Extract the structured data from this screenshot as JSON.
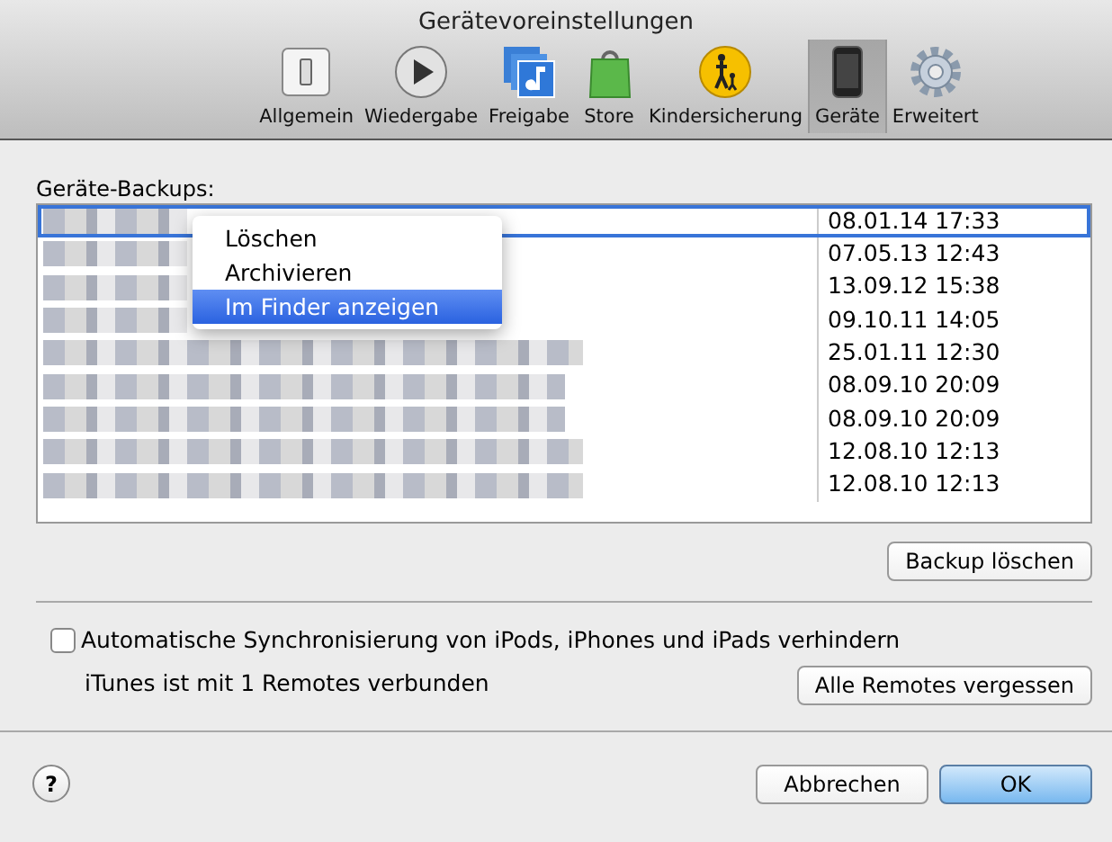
{
  "window": {
    "title": "Gerätevoreinstellungen"
  },
  "toolbar": [
    {
      "label": "Allgemein",
      "kind": "switch",
      "selected": false
    },
    {
      "label": "Wiedergabe",
      "kind": "play",
      "selected": false
    },
    {
      "label": "Freigabe",
      "kind": "sharing",
      "selected": false
    },
    {
      "label": "Store",
      "kind": "store",
      "selected": false
    },
    {
      "label": "Kindersicherung",
      "kind": "parental",
      "selected": false
    },
    {
      "label": "Geräte",
      "kind": "device",
      "selected": true
    },
    {
      "label": "Erweitert",
      "kind": "gear",
      "selected": false
    }
  ],
  "backups": {
    "label": "Geräte-Backups:",
    "rows": [
      {
        "date": "08.01.14 17:33",
        "selected": true
      },
      {
        "date": "07.05.13 12:43",
        "selected": false
      },
      {
        "date": "13.09.12 15:38",
        "selected": false
      },
      {
        "date": "09.10.11 14:05",
        "selected": false
      },
      {
        "date": "25.01.11 12:30",
        "selected": false
      },
      {
        "date": "08.09.10 20:09",
        "selected": false
      },
      {
        "date": "08.09.10 20:09",
        "selected": false
      },
      {
        "date": "12.08.10 12:13",
        "selected": false
      },
      {
        "date": "12.08.10 12:13",
        "selected": false
      }
    ]
  },
  "context_menu": [
    {
      "label": "Löschen",
      "selected": false
    },
    {
      "label": "Archivieren",
      "selected": false
    },
    {
      "label": "Im Finder anzeigen",
      "selected": true
    }
  ],
  "delete_button": "Backup löschen",
  "sync_option": {
    "label": "Automatische Synchronisierung von iPods, iPhones und iPads verhindern",
    "checked": false
  },
  "remotes": {
    "text": "iTunes ist mit 1 Remotes verbunden",
    "button": "Alle Remotes vergessen"
  },
  "help": "?",
  "buttons": [
    {
      "label": "Abbrechen",
      "default": false
    },
    {
      "label": "OK",
      "default": true
    }
  ]
}
